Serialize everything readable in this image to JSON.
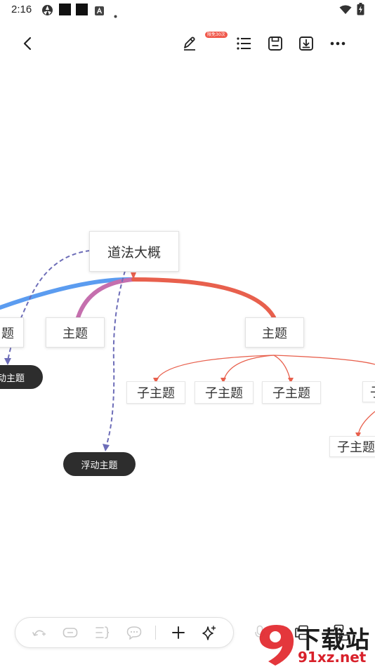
{
  "status_bar": {
    "time": "2:16",
    "icons": [
      "aperture-icon",
      "square-icon",
      "square-icon",
      "notification-a-icon",
      "dot-icon",
      "wifi-icon",
      "battery-icon"
    ]
  },
  "toolbar": {
    "back_icon": "chevron-left-icon",
    "pen_icon": "pen-icon",
    "pen_badge": "限免30次",
    "outline_icon": "list-icon",
    "save_icon": "save-icon",
    "export_icon": "download-icon",
    "more_icon": "more-horizontal-icon"
  },
  "mindmap": {
    "root": "道法大概",
    "topics": [
      "题",
      "主题",
      "主题"
    ],
    "subtopics": [
      "子主题",
      "子主题",
      "子主题",
      "子",
      "子主题"
    ],
    "floating": [
      "动主题",
      "浮动主题"
    ],
    "colors": {
      "blue_branch": "#5b9cf0",
      "pink_branch": "#c56fae",
      "red_branch": "#e8604d",
      "relation_line": "#6d6db8",
      "floating_bg": "#2d2d2d"
    }
  },
  "bottom_bar": {
    "icons": [
      "undo-icon",
      "topic-icon",
      "summary-icon",
      "comment-icon",
      "add-icon",
      "sparkle-icon"
    ],
    "side_icons": [
      "mic-icon",
      "layout-icon",
      "structure-icon"
    ]
  },
  "watermark": {
    "top_text": "下载站",
    "bottom_text": "91xz.net"
  }
}
